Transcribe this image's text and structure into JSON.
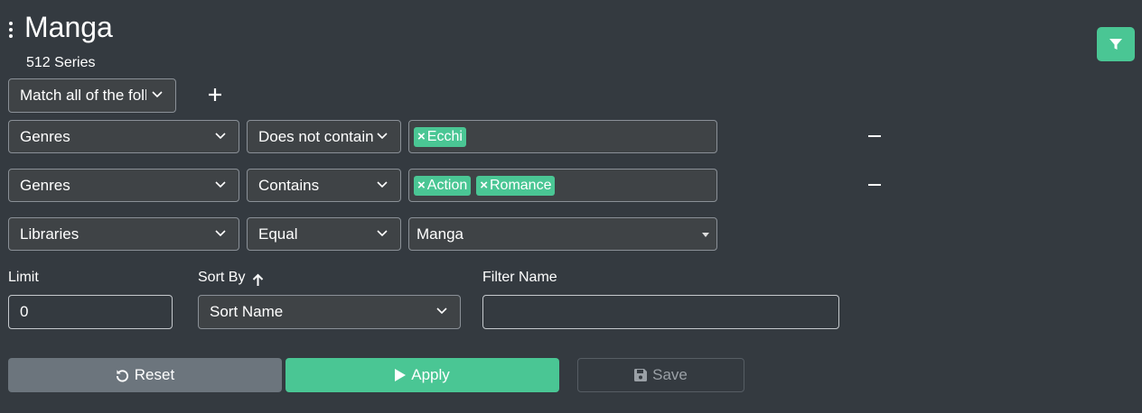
{
  "header": {
    "title": "Manga",
    "count": "512 Series"
  },
  "match": {
    "value": "Match all of the following"
  },
  "rows": [
    {
      "field": "Genres",
      "operator": "Does not contain",
      "tags": [
        "Ecchi"
      ]
    },
    {
      "field": "Genres",
      "operator": "Contains",
      "tags": [
        "Action",
        "Romance"
      ]
    },
    {
      "field": "Libraries",
      "operator": "Equal",
      "value": "Manga"
    }
  ],
  "limit": {
    "label": "Limit",
    "value": "0"
  },
  "sort": {
    "label": "Sort By",
    "value": "Sort Name"
  },
  "filter_name": {
    "label": "Filter Name",
    "value": ""
  },
  "buttons": {
    "reset": "Reset",
    "apply": "Apply",
    "save": "Save"
  },
  "colors": {
    "background": "#343a40",
    "accent": "#4ac694",
    "secondary": "#6c757d"
  }
}
